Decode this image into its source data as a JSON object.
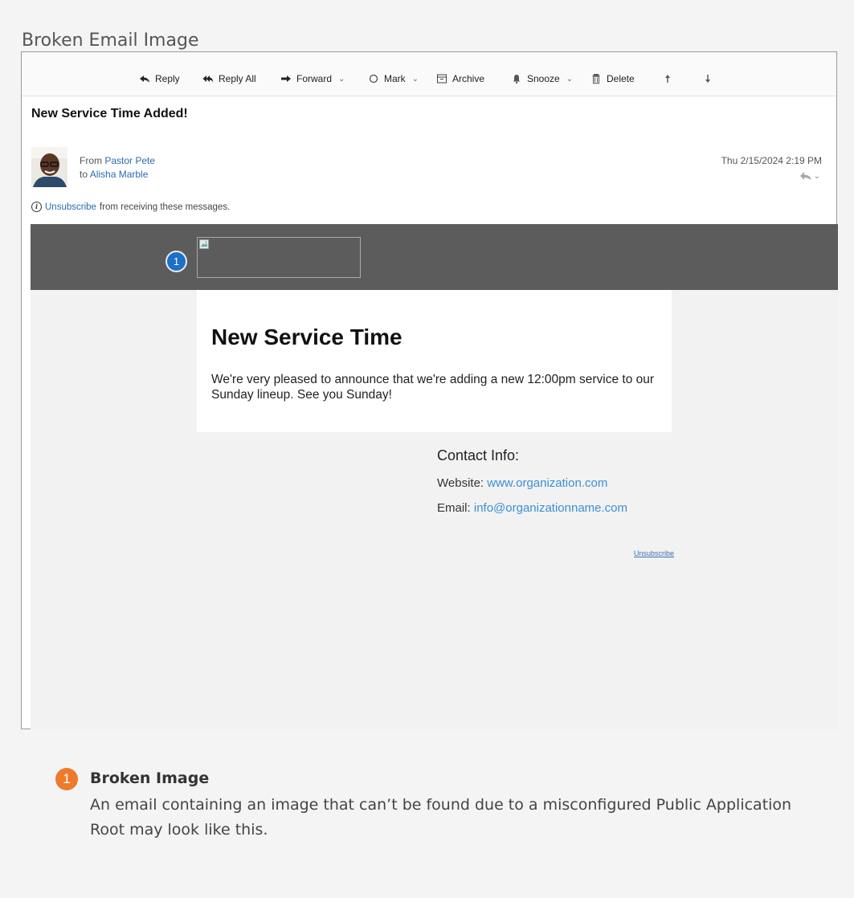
{
  "page_title": "Broken Email Image",
  "toolbar": {
    "reply": "Reply",
    "reply_all": "Reply All",
    "forward": "Forward",
    "mark": "Mark",
    "archive": "Archive",
    "snooze": "Snooze",
    "delete": "Delete"
  },
  "message": {
    "subject": "New Service Time Added!",
    "from_prefix": "From",
    "from_name": "Pastor Pete",
    "to_prefix": "to",
    "to_name": "Alisha Marble",
    "date": "Thu 2/15/2024 2:19 PM",
    "unsubscribe_link": "Unsubscribe",
    "unsubscribe_rest": "from receiving these messages."
  },
  "email": {
    "badge_number": "1",
    "heading": "New Service Time",
    "body": "We're very pleased to announce that we're adding a new 12:00pm service to our Sunday lineup. See you Sunday!",
    "contact_title": "Contact Info:",
    "website_label": "Website:",
    "website_value": "www.organization.com",
    "email_label": "Email:",
    "email_value": "info@organizationname.com",
    "footer_unsubscribe": "Unsubscribe"
  },
  "callout": {
    "number": "1",
    "title": "Broken Image",
    "text": "An email containing an image that can’t be found due to a misconfigured Public Application Root may look like this."
  },
  "colors": {
    "badge_blue": "#1e6fc7",
    "badge_orange": "#ee7a2c",
    "header_band": "#5c5c5c",
    "link": "#3b8fd6"
  }
}
